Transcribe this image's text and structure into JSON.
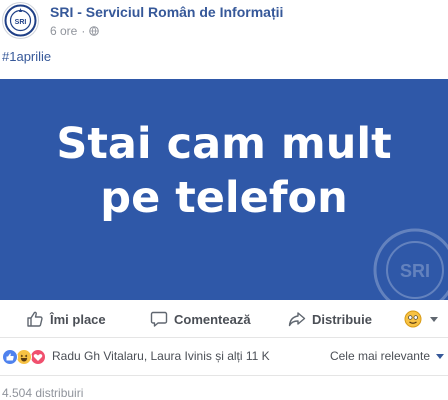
{
  "post": {
    "page_name": "SRI - Serviciul Român de Informații",
    "time": "6 ore",
    "separator": "·",
    "privacy_icon": "globe-icon",
    "hashtag": "#1aprilie",
    "image": {
      "line1": "Stai cam mult",
      "line2": "pe telefon",
      "background": "#2f58a8",
      "watermark_text": "SRI"
    }
  },
  "actions": {
    "like_label": "Îmi place",
    "comment_label": "Comentează",
    "share_label": "Distribuie"
  },
  "reactions": {
    "icons": [
      "like-icon",
      "haha-icon",
      "love-icon"
    ],
    "summary": "Radu Gh Vitalaru, Laura Ivinis și alți 11 K",
    "sort_label": "Cele mai relevante"
  },
  "shares": {
    "count_text": "4.504 distribuiri"
  },
  "colors": {
    "link": "#365899",
    "muted": "#90949c",
    "action": "#4b4f56"
  }
}
